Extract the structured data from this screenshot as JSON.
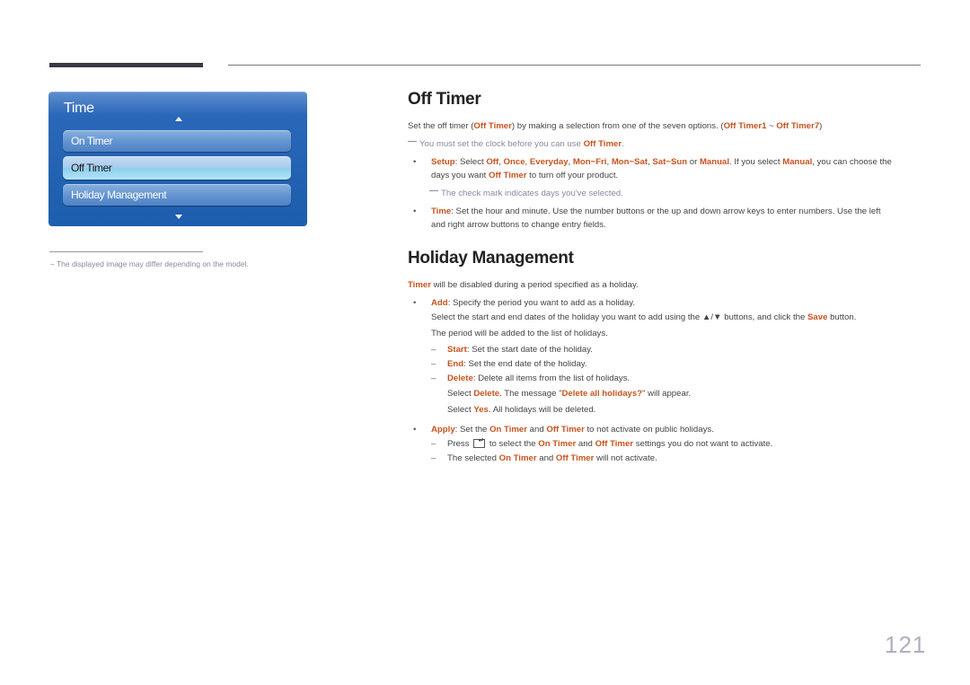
{
  "osd": {
    "title": "Time",
    "items": [
      "On Timer",
      "Off Timer",
      "Holiday Management"
    ],
    "selected_index": 1
  },
  "footnote": "The displayed image may differ depending on the model.",
  "off_timer": {
    "heading": "Off Timer",
    "intro": [
      "Set the off timer (",
      "Off Timer",
      ") by making a selection from one of the seven options. (",
      "Off Timer1",
      " ~ ",
      "Off Timer7",
      ")"
    ],
    "note1": [
      "You must set the clock before you can use ",
      "Off Timer",
      "."
    ],
    "setup_line1": [
      "Setup",
      ": Select ",
      "Off",
      ", ",
      "Once",
      ", ",
      "Everyday",
      ", ",
      "Mon~Fri",
      ", ",
      "Mon~Sat",
      ", ",
      "Sat~Sun",
      " or ",
      "Manual",
      ". If you select ",
      "Manual",
      ", you can choose the"
    ],
    "setup_line2": [
      "days you want ",
      "Off Timer",
      " to turn off your product."
    ],
    "note2": "The check mark indicates days you've selected.",
    "time_line1": [
      "Time",
      ": Set the hour and minute. Use the number buttons or the up and down arrow keys to enter numbers. Use the left"
    ],
    "time_line2": "and right arrow buttons to change entry fields."
  },
  "holiday": {
    "heading": "Holiday Management",
    "intro": [
      "Timer",
      " will be disabled during a period specified as a holiday."
    ],
    "add_line1": [
      "Add",
      ": Specify the period you want to add as a holiday."
    ],
    "add_line2": [
      "Select the start and end dates of the holiday you want to add using the ▲/▼ buttons, and click the ",
      "Save",
      " button."
    ],
    "add_line3": "The period will be added to the list of holidays.",
    "start": [
      "Start",
      ": Set the start date of the holiday."
    ],
    "end": [
      "End",
      ": Set the end date of the holiday."
    ],
    "delete1": [
      "Delete",
      ": Delete all items from the list of holidays."
    ],
    "delete2": [
      "Select ",
      "Delete",
      ". The message \"",
      "Delete all holidays?",
      "\" will appear."
    ],
    "delete3": [
      "Select ",
      "Yes",
      ". All holidays will be deleted."
    ],
    "apply1": [
      "Apply",
      ": Set the ",
      "On Timer",
      " and ",
      "Off Timer",
      " to not activate on public holidays."
    ],
    "apply2a": "Press ",
    "apply2b": [
      " to select the ",
      "On Timer",
      " and ",
      "Off Timer",
      " settings you do not want to activate."
    ],
    "apply3": [
      "The selected ",
      "On Timer",
      " and ",
      "Off Timer",
      " will not activate."
    ]
  },
  "page_number": "121",
  "colors": {
    "highlight": "#c8531f",
    "osd_blue": "#1d5dae",
    "note_gray": "#8a8aa0"
  }
}
